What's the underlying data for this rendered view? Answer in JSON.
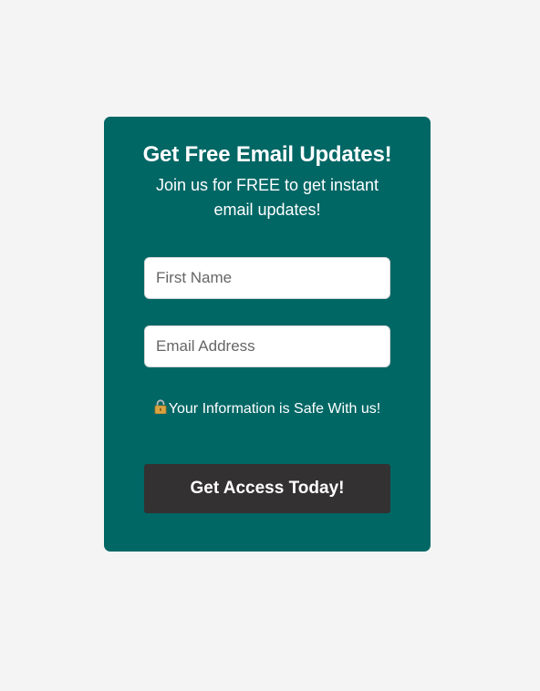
{
  "form": {
    "headline": "Get Free Email Updates!",
    "subtext": "Join us for FREE to get instant email updates!",
    "first_name_placeholder": "First Name",
    "email_placeholder": "Email Address",
    "safe_note": "Your Information is Safe With us!",
    "lock_icon": "padlock-icon",
    "submit_label": "Get Access Today!"
  },
  "colors": {
    "page_background": "#f4f4f4",
    "card_background": "#006765",
    "button_background": "#333132",
    "text": "#ffffff"
  }
}
